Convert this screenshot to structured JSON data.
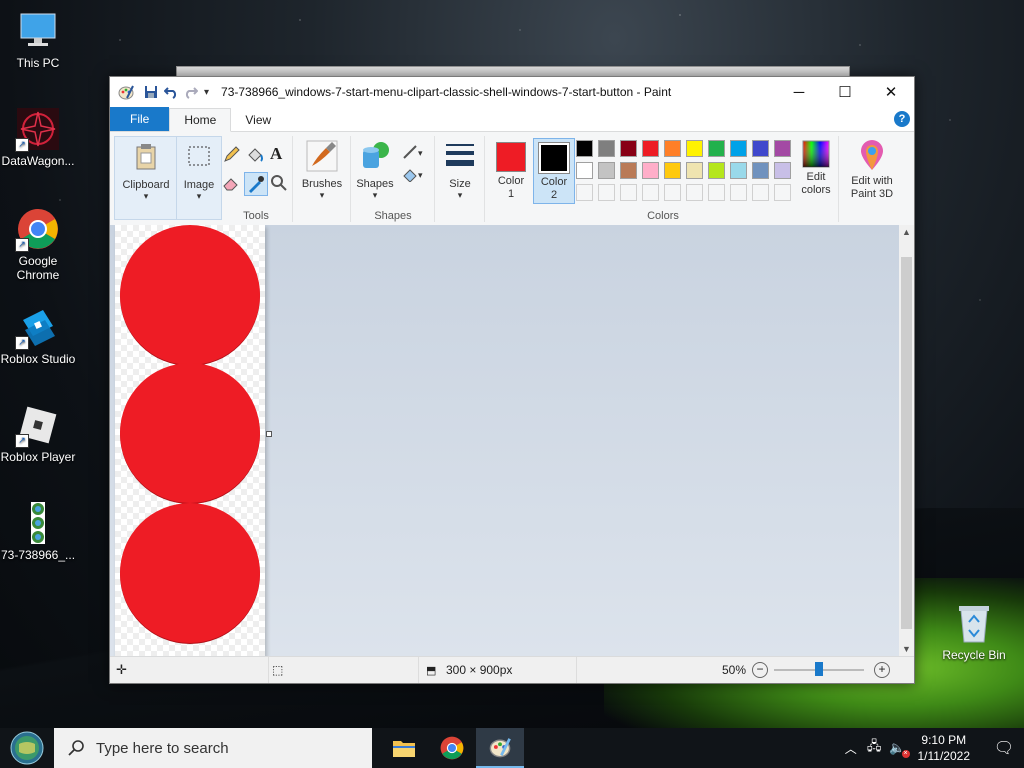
{
  "desktop": {
    "icons": [
      {
        "label": "This PC",
        "icon": "monitor-icon"
      },
      {
        "label": "DataWagon...",
        "icon": "datawagon-icon"
      },
      {
        "label": "Google Chrome",
        "icon": "chrome-icon"
      },
      {
        "label": "Roblox Studio",
        "icon": "roblox-studio-icon"
      },
      {
        "label": "Roblox Player",
        "icon": "roblox-player-icon"
      },
      {
        "label": "73-738966_...",
        "icon": "image-file-icon"
      },
      {
        "label": "Recycle Bin",
        "icon": "recycle-bin-icon"
      }
    ]
  },
  "window": {
    "title": "73-738966_windows-7-start-menu-clipart-classic-shell-windows-7-start-button - Paint",
    "controls": {
      "minimize": "─",
      "maximize": "☐",
      "close": "✕"
    }
  },
  "ribbon": {
    "tabs": [
      "File",
      "Home",
      "View"
    ],
    "help": "?",
    "clipboard": "Clipboard",
    "image": "Image",
    "tools_label": "Tools",
    "brushes": "Brushes",
    "shapes": "Shapes",
    "shapes_label": "Shapes",
    "size": "Size",
    "color1": "Color 1",
    "color2": "Color 2",
    "colors_label": "Colors",
    "edit_colors": "Edit colors",
    "paint3d": "Edit with Paint 3D",
    "color1_value": "#ee1c25",
    "color2_value": "#000000",
    "palette_row1": [
      "#000000",
      "#7f7f7f",
      "#880015",
      "#ed1c24",
      "#ff7f27",
      "#fff200",
      "#22b14c",
      "#00a2e8",
      "#3f48cc",
      "#a349a4"
    ],
    "palette_row2": [
      "#ffffff",
      "#c3c3c3",
      "#b97a57",
      "#ffaec9",
      "#ffc90e",
      "#efe4b0",
      "#b5e61d",
      "#99d9ea",
      "#7092be",
      "#c8bfe7"
    ]
  },
  "status": {
    "dimensions": "300 × 900px",
    "zoom": "50%",
    "zoom_level": 0.5
  },
  "taskbar": {
    "search_placeholder": "Type here to search",
    "time": "9:10 PM",
    "date": "1/11/2022"
  }
}
